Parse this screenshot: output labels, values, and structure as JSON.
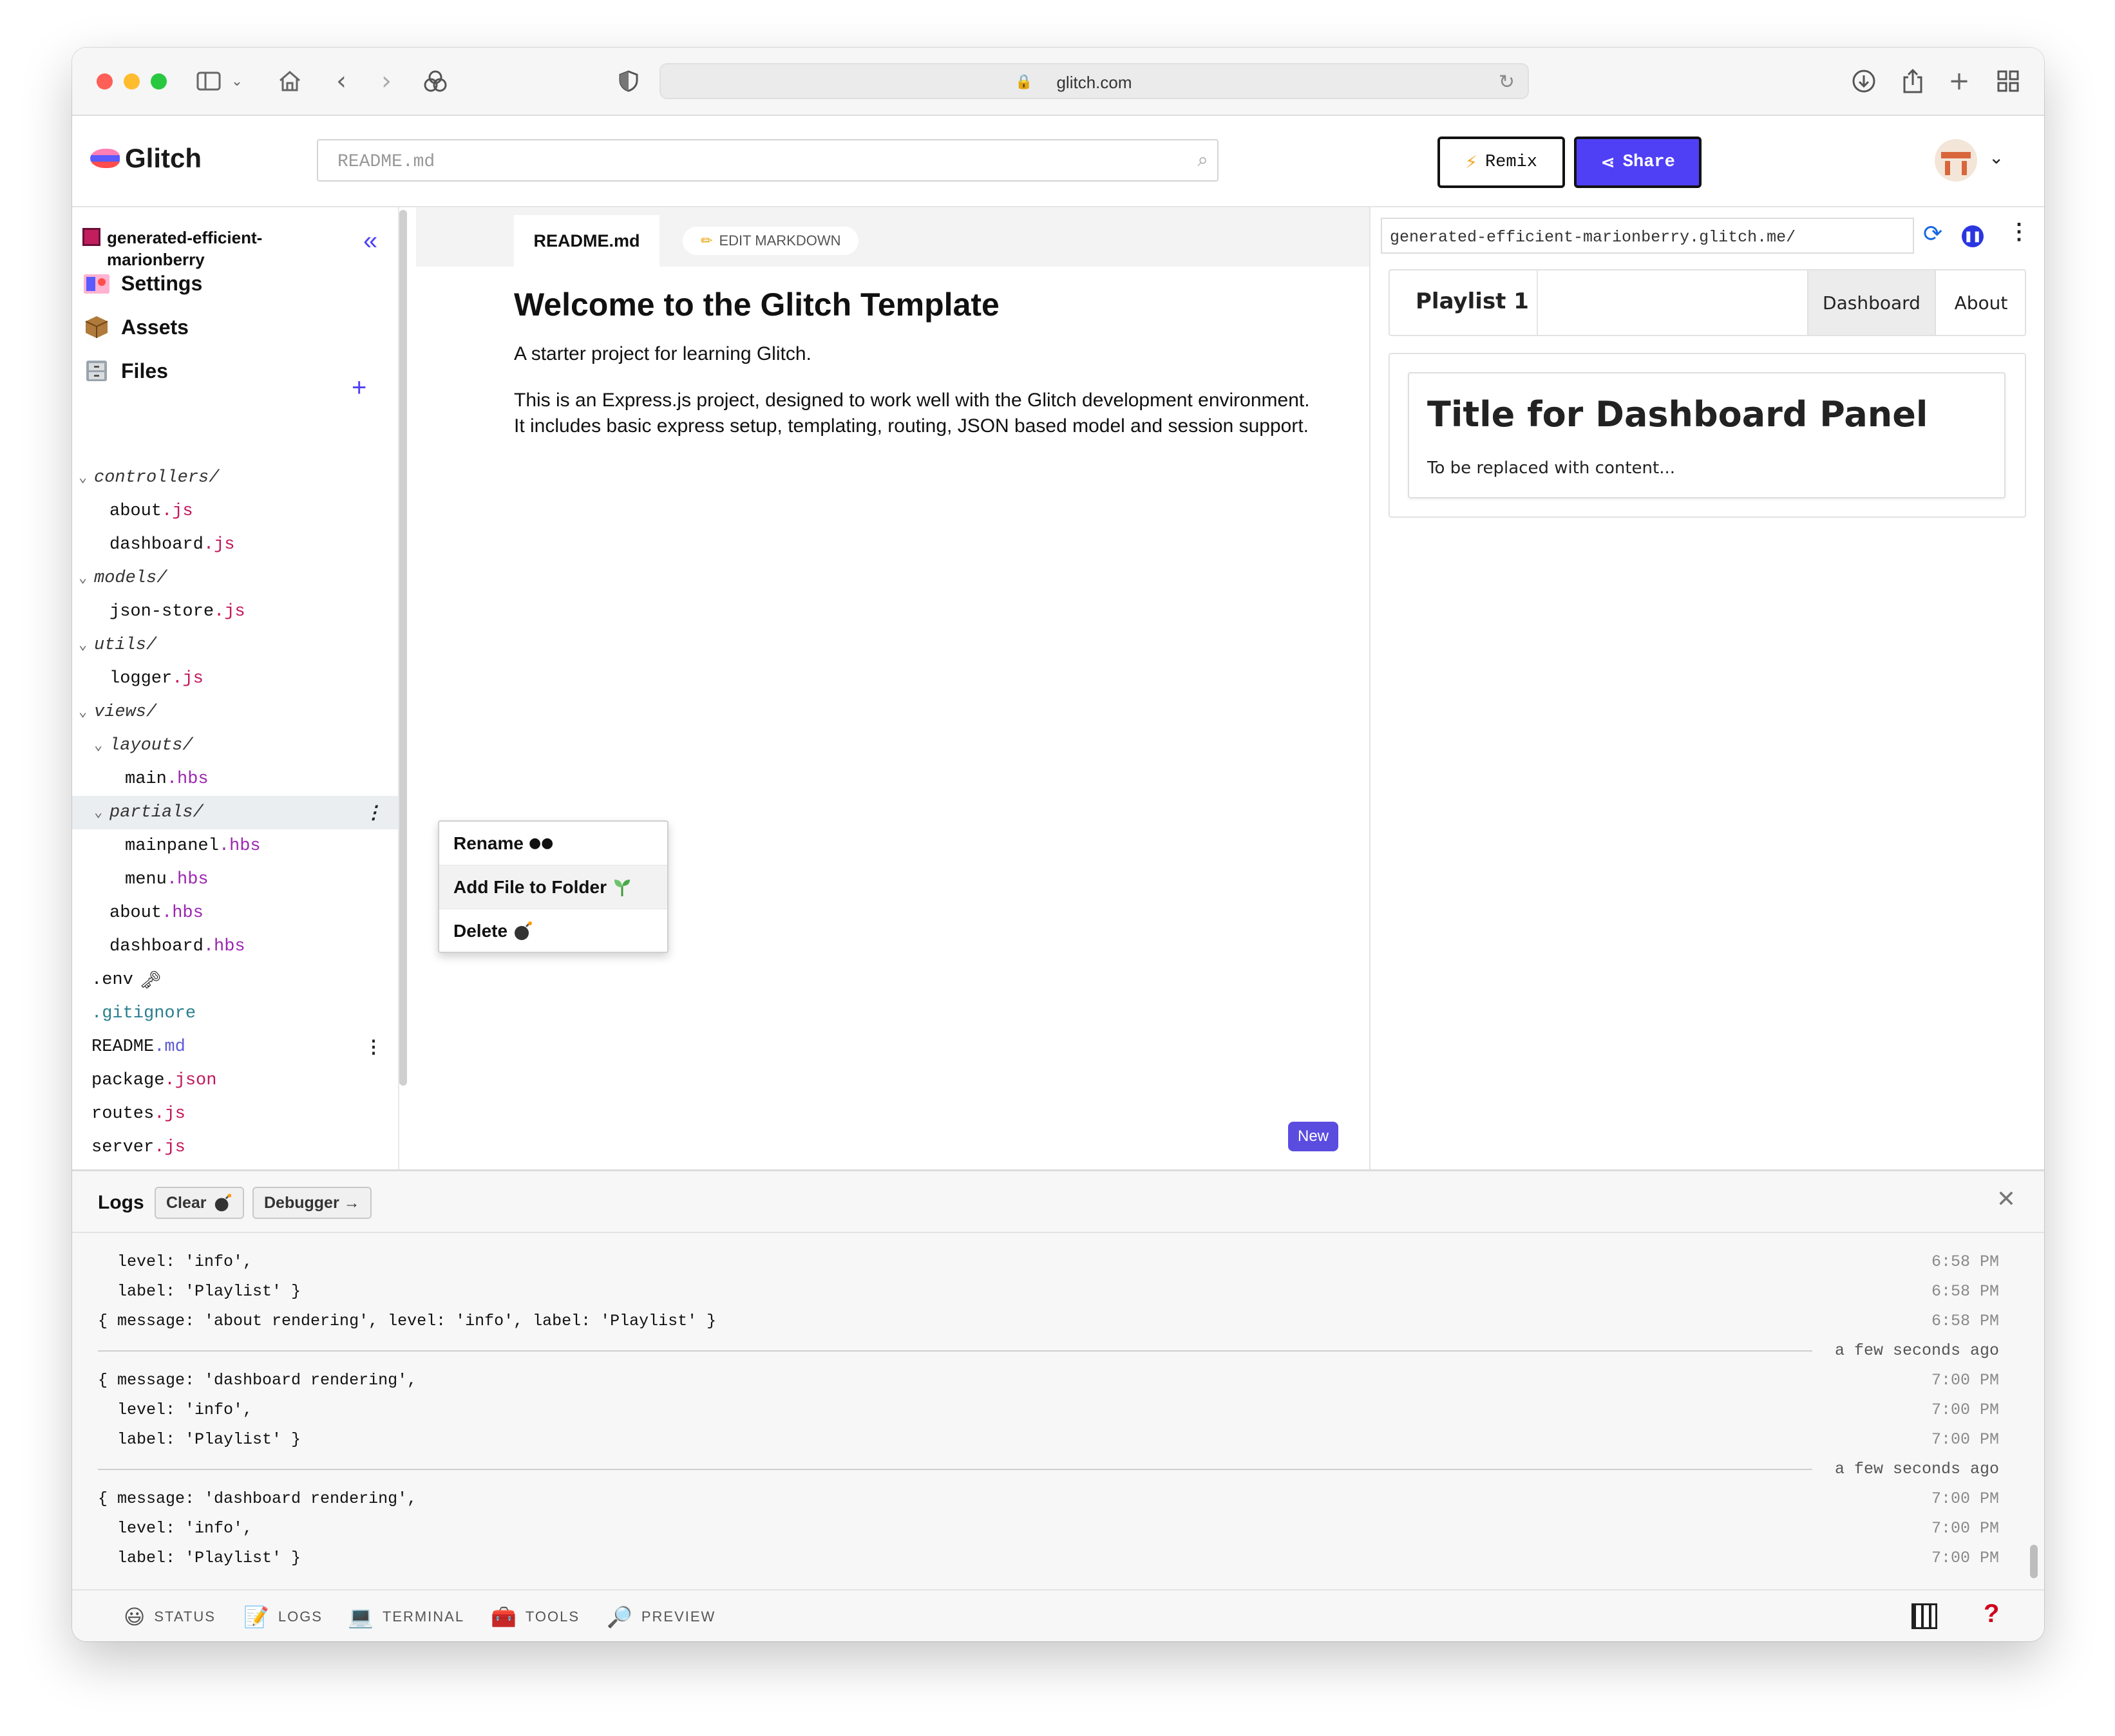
{
  "browser": {
    "url": "glitch.com"
  },
  "header": {
    "logo": "Glitch",
    "search_placeholder": "README.md",
    "remix_label": "Remix",
    "share_label": "Share"
  },
  "sidebar": {
    "project_name": "generated-efficient-marionberry",
    "nav": [
      {
        "label": "Settings",
        "icon": "gear-emoji-icon"
      },
      {
        "label": "Assets",
        "icon": "box-icon"
      },
      {
        "label": "Files",
        "icon": "file-cabinet-icon"
      }
    ],
    "tree": [
      {
        "name": "controllers/",
        "ext": "",
        "type": "folder",
        "depth": 0
      },
      {
        "name": "about",
        "ext": ".js",
        "type": "file",
        "depth": 1
      },
      {
        "name": "dashboard",
        "ext": ".js",
        "type": "file",
        "depth": 1
      },
      {
        "name": "models/",
        "ext": "",
        "type": "folder",
        "depth": 0
      },
      {
        "name": "json-store",
        "ext": ".js",
        "type": "file",
        "depth": 1
      },
      {
        "name": "utils/",
        "ext": "",
        "type": "folder",
        "depth": 0
      },
      {
        "name": "logger",
        "ext": ".js",
        "type": "file",
        "depth": 1
      },
      {
        "name": "views/",
        "ext": "",
        "type": "folder",
        "depth": 0
      },
      {
        "name": "layouts/",
        "ext": "",
        "type": "folder",
        "depth": 1
      },
      {
        "name": "main",
        "ext": ".hbs",
        "type": "file",
        "depth": 2
      },
      {
        "name": "partials/",
        "ext": "",
        "type": "folder",
        "depth": 1,
        "selected": true
      },
      {
        "name": "mainpanel",
        "ext": ".hbs",
        "type": "file",
        "depth": 2
      },
      {
        "name": "menu",
        "ext": ".hbs",
        "type": "file",
        "depth": 2
      },
      {
        "name": "about",
        "ext": ".hbs",
        "type": "file",
        "depth": 1
      },
      {
        "name": "dashboard",
        "ext": ".hbs",
        "type": "file",
        "depth": 1
      },
      {
        "name": ".env",
        "ext": "",
        "type": "file",
        "depth": 0,
        "suffix": "🗝"
      },
      {
        "name": ".gitignore",
        "ext": "",
        "type": "file",
        "depth": 0,
        "color": "cyan"
      },
      {
        "name": "README",
        "ext": ".md",
        "type": "file",
        "depth": 0
      },
      {
        "name": "package",
        "ext": ".json",
        "type": "file",
        "depth": 0
      },
      {
        "name": "routes",
        "ext": ".js",
        "type": "file",
        "depth": 0
      },
      {
        "name": "server",
        "ext": ".js",
        "type": "file",
        "depth": 0
      }
    ]
  },
  "context_menu": {
    "items": [
      {
        "label": "Rename",
        "emoji": "👀"
      },
      {
        "label": "Add File to Folder",
        "emoji": "🌱"
      },
      {
        "label": "Delete",
        "emoji": "💣"
      }
    ]
  },
  "editor": {
    "tab_label": "README.md",
    "edit_button": "EDIT MARKDOWN",
    "heading": "Welcome to the Glitch Template",
    "para1": "A starter project for learning Glitch.",
    "para2": "This is an Express.js project, designed to work well with the Glitch development environment. It includes basic express setup, templating, routing, JSON based model and session support.",
    "new_badge": "New"
  },
  "preview": {
    "url": "generated-efficient-marionberry.glitch.me/",
    "brand": "Playlist 1",
    "menu": [
      "Dashboard",
      "About"
    ],
    "card_title": "Title for Dashboard Panel",
    "card_body": "To be replaced with content..."
  },
  "logs": {
    "title": "Logs",
    "clear_label": "Clear",
    "debugger_label": "Debugger →",
    "lines": [
      {
        "text": "  level: 'info',",
        "time": "6:58 PM",
        "sep": false
      },
      {
        "text": "  label: 'Playlist' }",
        "time": "6:58 PM",
        "sep": false
      },
      {
        "text": "{ message: 'about rendering', level: 'info', label: 'Playlist' }",
        "time": "6:58 PM",
        "sep": false
      },
      {
        "text": "",
        "time": "a few seconds ago",
        "sep": true
      },
      {
        "text": "{ message: 'dashboard rendering',",
        "time": "7:00 PM",
        "sep": false
      },
      {
        "text": "  level: 'info',",
        "time": "7:00 PM",
        "sep": false
      },
      {
        "text": "  label: 'Playlist' }",
        "time": "7:00 PM",
        "sep": false
      },
      {
        "text": "",
        "time": "a few seconds ago",
        "sep": true
      },
      {
        "text": "{ message: 'dashboard rendering',",
        "time": "7:00 PM",
        "sep": false
      },
      {
        "text": "  level: 'info',",
        "time": "7:00 PM",
        "sep": false
      },
      {
        "text": "  label: 'Playlist' }",
        "time": "7:00 PM",
        "sep": false
      }
    ]
  },
  "bottombar": {
    "items": [
      {
        "label": "STATUS",
        "icon": "😃"
      },
      {
        "label": "LOGS",
        "icon": "📝"
      },
      {
        "label": "TERMINAL",
        "icon": "💻"
      },
      {
        "label": "TOOLS",
        "icon": "🧰"
      },
      {
        "label": "PREVIEW",
        "icon": "🔎"
      }
    ],
    "help": "?"
  }
}
